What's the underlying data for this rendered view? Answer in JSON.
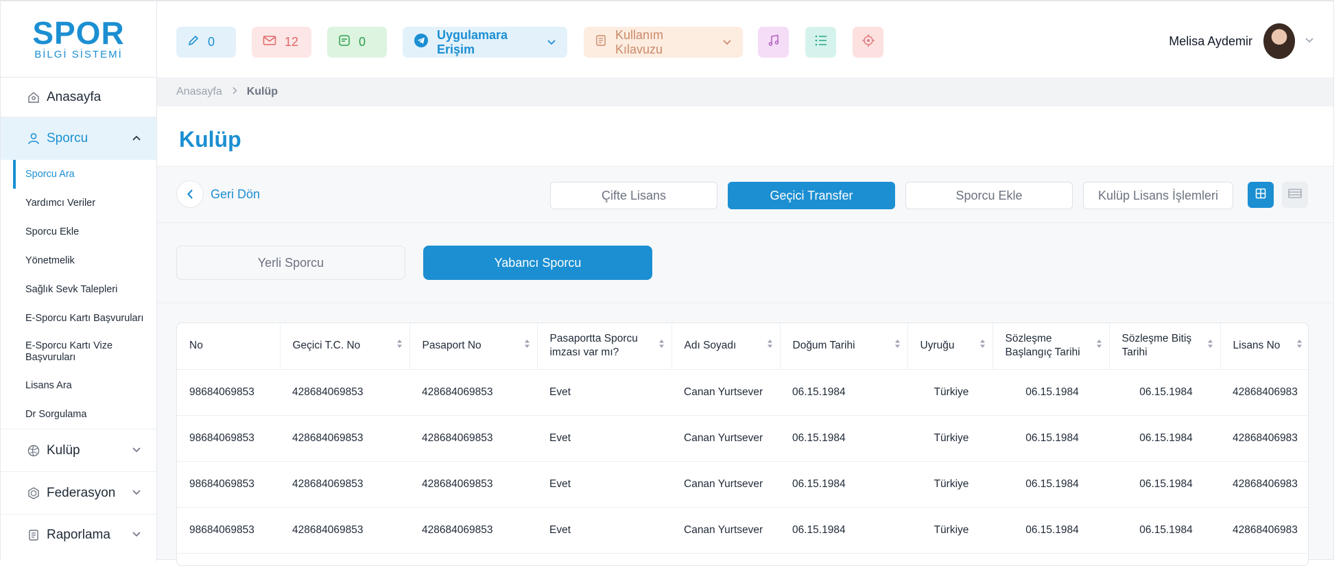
{
  "logo": {
    "main": "SPOR",
    "sub": "BİLGİ SİSTEMİ"
  },
  "sidebar": {
    "home": "Anasayfa",
    "sporcu": "Sporcu",
    "sub_items": [
      "Sporcu Ara",
      "Yardımcı Veriler",
      "Sporcu Ekle",
      "Yönetmelik",
      "Sağlık Sevk Talepleri",
      "E-Sporcu Kartı Başvuruları",
      "E-Sporcu Kartı Vize Başvuruları",
      "Lisans Ara",
      "Dr Sorgulama"
    ],
    "kulup": "Kulüp",
    "federasyon": "Federasyon",
    "raporlama": "Raporlama"
  },
  "topbar": {
    "edit_count": "0",
    "mail_count": "12",
    "note_count": "0",
    "app_access": "Uygulamara Erişim",
    "guide": "Kullanım Kılavuzu",
    "user_name": "Melisa Aydemir"
  },
  "breadcrumb": {
    "home": "Anasayfa",
    "current": "Kulüp"
  },
  "page": {
    "title": "Kulüp",
    "back": "Geri Dön",
    "tabs": [
      "Çifte Lisans",
      "Geçici Transfer",
      "Sporcu Ekle",
      "Kulüp Lisans İşlemleri"
    ],
    "segments": [
      "Yerli Sporcu",
      "Yabancı Sporcu"
    ]
  },
  "table": {
    "headers": [
      "No",
      "Geçici T.C. No",
      "Pasaport No",
      "Pasaportta Sporcu imzası var mı?",
      "Adı Soyadı",
      "Doğum Tarihi",
      "Uyruğu",
      "Sözleşme Başlangıç Tarihi",
      "Sözleşme Bitiş Tarihi",
      "Lisans No"
    ],
    "rows": [
      [
        "98684069853",
        "428684069853",
        "428684069853",
        "Evet",
        "Canan Yurtsever",
        "06.15.1984",
        "Türkiye",
        "06.15.1984",
        "06.15.1984",
        "42868406983"
      ],
      [
        "98684069853",
        "428684069853",
        "428684069853",
        "Evet",
        "Canan Yurtsever",
        "06.15.1984",
        "Türkiye",
        "06.15.1984",
        "06.15.1984",
        "42868406983"
      ],
      [
        "98684069853",
        "428684069853",
        "428684069853",
        "Evet",
        "Canan Yurtsever",
        "06.15.1984",
        "Türkiye",
        "06.15.1984",
        "06.15.1984",
        "42868406983"
      ],
      [
        "98684069853",
        "428684069853",
        "428684069853",
        "Evet",
        "Canan Yurtsever",
        "06.15.1984",
        "Türkiye",
        "06.15.1984",
        "06.15.1984",
        "42868406983"
      ]
    ]
  },
  "colors": {
    "accent": "#1b8fd2",
    "muted": "#6b7280",
    "band": "#f7f8fa"
  }
}
